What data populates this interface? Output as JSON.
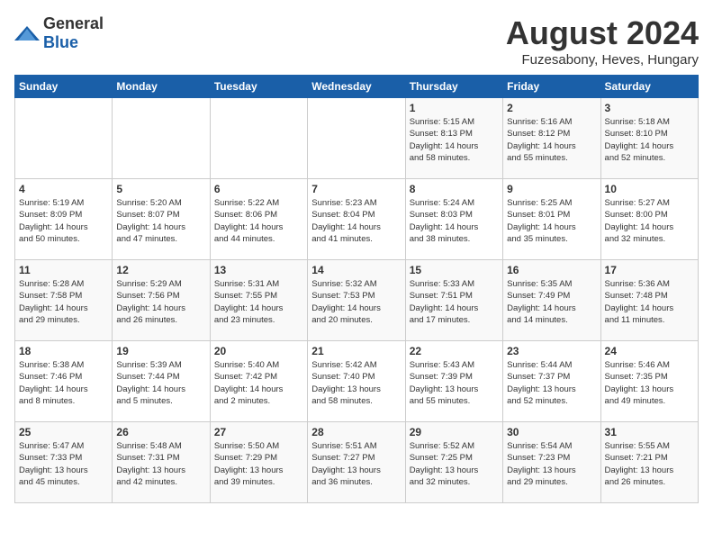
{
  "header": {
    "logo_general": "General",
    "logo_blue": "Blue",
    "title": "August 2024",
    "subtitle": "Fuzesabony, Heves, Hungary"
  },
  "days_of_week": [
    "Sunday",
    "Monday",
    "Tuesday",
    "Wednesday",
    "Thursday",
    "Friday",
    "Saturday"
  ],
  "weeks": [
    [
      {
        "day": "",
        "info": ""
      },
      {
        "day": "",
        "info": ""
      },
      {
        "day": "",
        "info": ""
      },
      {
        "day": "",
        "info": ""
      },
      {
        "day": "1",
        "info": "Sunrise: 5:15 AM\nSunset: 8:13 PM\nDaylight: 14 hours\nand 58 minutes."
      },
      {
        "day": "2",
        "info": "Sunrise: 5:16 AM\nSunset: 8:12 PM\nDaylight: 14 hours\nand 55 minutes."
      },
      {
        "day": "3",
        "info": "Sunrise: 5:18 AM\nSunset: 8:10 PM\nDaylight: 14 hours\nand 52 minutes."
      }
    ],
    [
      {
        "day": "4",
        "info": "Sunrise: 5:19 AM\nSunset: 8:09 PM\nDaylight: 14 hours\nand 50 minutes."
      },
      {
        "day": "5",
        "info": "Sunrise: 5:20 AM\nSunset: 8:07 PM\nDaylight: 14 hours\nand 47 minutes."
      },
      {
        "day": "6",
        "info": "Sunrise: 5:22 AM\nSunset: 8:06 PM\nDaylight: 14 hours\nand 44 minutes."
      },
      {
        "day": "7",
        "info": "Sunrise: 5:23 AM\nSunset: 8:04 PM\nDaylight: 14 hours\nand 41 minutes."
      },
      {
        "day": "8",
        "info": "Sunrise: 5:24 AM\nSunset: 8:03 PM\nDaylight: 14 hours\nand 38 minutes."
      },
      {
        "day": "9",
        "info": "Sunrise: 5:25 AM\nSunset: 8:01 PM\nDaylight: 14 hours\nand 35 minutes."
      },
      {
        "day": "10",
        "info": "Sunrise: 5:27 AM\nSunset: 8:00 PM\nDaylight: 14 hours\nand 32 minutes."
      }
    ],
    [
      {
        "day": "11",
        "info": "Sunrise: 5:28 AM\nSunset: 7:58 PM\nDaylight: 14 hours\nand 29 minutes."
      },
      {
        "day": "12",
        "info": "Sunrise: 5:29 AM\nSunset: 7:56 PM\nDaylight: 14 hours\nand 26 minutes."
      },
      {
        "day": "13",
        "info": "Sunrise: 5:31 AM\nSunset: 7:55 PM\nDaylight: 14 hours\nand 23 minutes."
      },
      {
        "day": "14",
        "info": "Sunrise: 5:32 AM\nSunset: 7:53 PM\nDaylight: 14 hours\nand 20 minutes."
      },
      {
        "day": "15",
        "info": "Sunrise: 5:33 AM\nSunset: 7:51 PM\nDaylight: 14 hours\nand 17 minutes."
      },
      {
        "day": "16",
        "info": "Sunrise: 5:35 AM\nSunset: 7:49 PM\nDaylight: 14 hours\nand 14 minutes."
      },
      {
        "day": "17",
        "info": "Sunrise: 5:36 AM\nSunset: 7:48 PM\nDaylight: 14 hours\nand 11 minutes."
      }
    ],
    [
      {
        "day": "18",
        "info": "Sunrise: 5:38 AM\nSunset: 7:46 PM\nDaylight: 14 hours\nand 8 minutes."
      },
      {
        "day": "19",
        "info": "Sunrise: 5:39 AM\nSunset: 7:44 PM\nDaylight: 14 hours\nand 5 minutes."
      },
      {
        "day": "20",
        "info": "Sunrise: 5:40 AM\nSunset: 7:42 PM\nDaylight: 14 hours\nand 2 minutes."
      },
      {
        "day": "21",
        "info": "Sunrise: 5:42 AM\nSunset: 7:40 PM\nDaylight: 13 hours\nand 58 minutes."
      },
      {
        "day": "22",
        "info": "Sunrise: 5:43 AM\nSunset: 7:39 PM\nDaylight: 13 hours\nand 55 minutes."
      },
      {
        "day": "23",
        "info": "Sunrise: 5:44 AM\nSunset: 7:37 PM\nDaylight: 13 hours\nand 52 minutes."
      },
      {
        "day": "24",
        "info": "Sunrise: 5:46 AM\nSunset: 7:35 PM\nDaylight: 13 hours\nand 49 minutes."
      }
    ],
    [
      {
        "day": "25",
        "info": "Sunrise: 5:47 AM\nSunset: 7:33 PM\nDaylight: 13 hours\nand 45 minutes."
      },
      {
        "day": "26",
        "info": "Sunrise: 5:48 AM\nSunset: 7:31 PM\nDaylight: 13 hours\nand 42 minutes."
      },
      {
        "day": "27",
        "info": "Sunrise: 5:50 AM\nSunset: 7:29 PM\nDaylight: 13 hours\nand 39 minutes."
      },
      {
        "day": "28",
        "info": "Sunrise: 5:51 AM\nSunset: 7:27 PM\nDaylight: 13 hours\nand 36 minutes."
      },
      {
        "day": "29",
        "info": "Sunrise: 5:52 AM\nSunset: 7:25 PM\nDaylight: 13 hours\nand 32 minutes."
      },
      {
        "day": "30",
        "info": "Sunrise: 5:54 AM\nSunset: 7:23 PM\nDaylight: 13 hours\nand 29 minutes."
      },
      {
        "day": "31",
        "info": "Sunrise: 5:55 AM\nSunset: 7:21 PM\nDaylight: 13 hours\nand 26 minutes."
      }
    ]
  ]
}
